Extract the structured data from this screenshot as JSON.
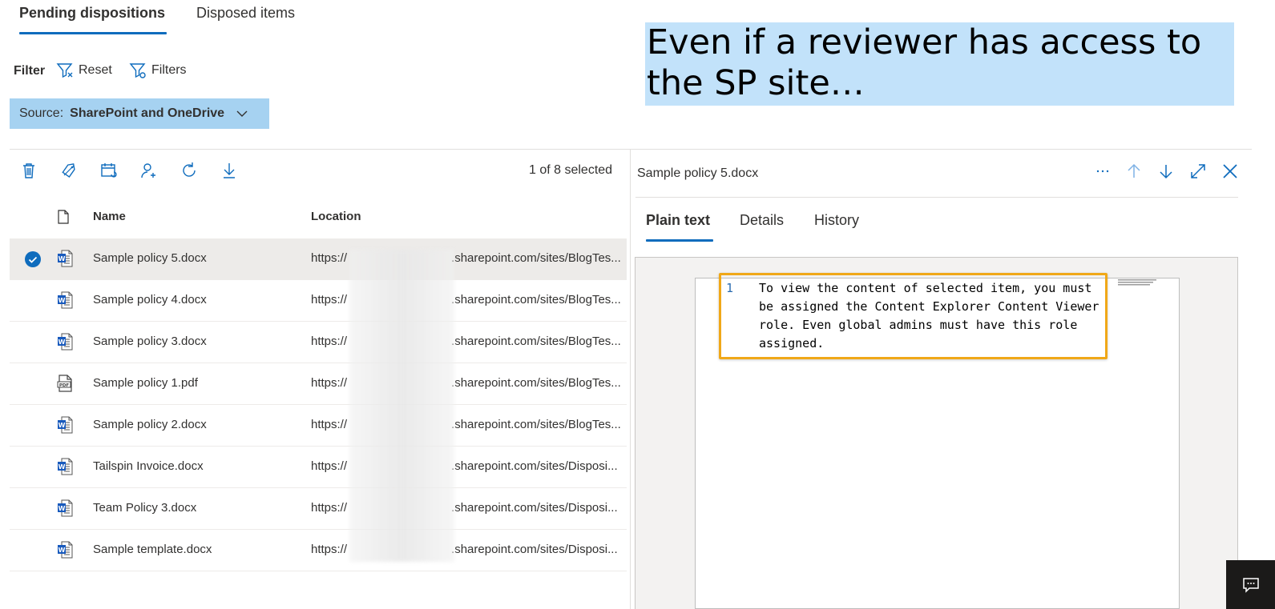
{
  "tabs": [
    {
      "label": "Pending dispositions",
      "active": true
    },
    {
      "label": "Disposed items",
      "active": false
    }
  ],
  "filter": {
    "label": "Filter",
    "reset_label": "Reset",
    "filters_label": "Filters",
    "source_label": "Source:",
    "source_value": "SharePoint and OneDrive"
  },
  "callout": {
    "text": "Even if a reviewer has access to the SP site…"
  },
  "toolbar": {
    "icons": [
      "delete-icon",
      "tag-icon",
      "extend-icon",
      "add-reviewer-icon",
      "refresh-icon",
      "download-icon"
    ],
    "selected_count": "1 of 8 selected"
  },
  "list": {
    "columns": {
      "name": "Name",
      "location": "Location"
    },
    "rows": [
      {
        "name": "Sample policy 5.docx",
        "type": "word",
        "selected": true,
        "loc_prefix": "https://",
        "loc_suffix": ".sharepoint.com/sites/BlogTes..."
      },
      {
        "name": "Sample policy 4.docx",
        "type": "word",
        "selected": false,
        "loc_prefix": "https://",
        "loc_suffix": ".sharepoint.com/sites/BlogTes..."
      },
      {
        "name": "Sample policy 3.docx",
        "type": "word",
        "selected": false,
        "loc_prefix": "https://",
        "loc_suffix": ".sharepoint.com/sites/BlogTes..."
      },
      {
        "name": "Sample policy 1.pdf",
        "type": "pdf",
        "selected": false,
        "loc_prefix": "https://",
        "loc_suffix": ".sharepoint.com/sites/BlogTes..."
      },
      {
        "name": "Sample policy 2.docx",
        "type": "word",
        "selected": false,
        "loc_prefix": "https://",
        "loc_suffix": ".sharepoint.com/sites/BlogTes..."
      },
      {
        "name": "Tailspin Invoice.docx",
        "type": "word",
        "selected": false,
        "loc_prefix": "https://",
        "loc_suffix": ".sharepoint.com/sites/Disposi..."
      },
      {
        "name": "Team Policy 3.docx",
        "type": "word",
        "selected": false,
        "loc_prefix": "https://",
        "loc_suffix": ".sharepoint.com/sites/Disposi..."
      },
      {
        "name": "Sample template.docx",
        "type": "word",
        "selected": false,
        "loc_prefix": "https://",
        "loc_suffix": ".sharepoint.com/sites/Disposi..."
      }
    ]
  },
  "detail": {
    "title": "Sample policy 5.docx",
    "tabs": [
      {
        "label": "Plain text",
        "active": true
      },
      {
        "label": "Details",
        "active": false
      },
      {
        "label": "History",
        "active": false
      }
    ],
    "line_number": "1",
    "content": "To view the content of selected item, you must be assigned the Content Explorer Content Viewer role. Even global admins must have this role assigned."
  },
  "colors": {
    "accent": "#0f6cbd",
    "source_pill_bg": "#a6d2f1",
    "callout_bg": "#c2e2fa",
    "highlight_border": "#f0a818"
  }
}
